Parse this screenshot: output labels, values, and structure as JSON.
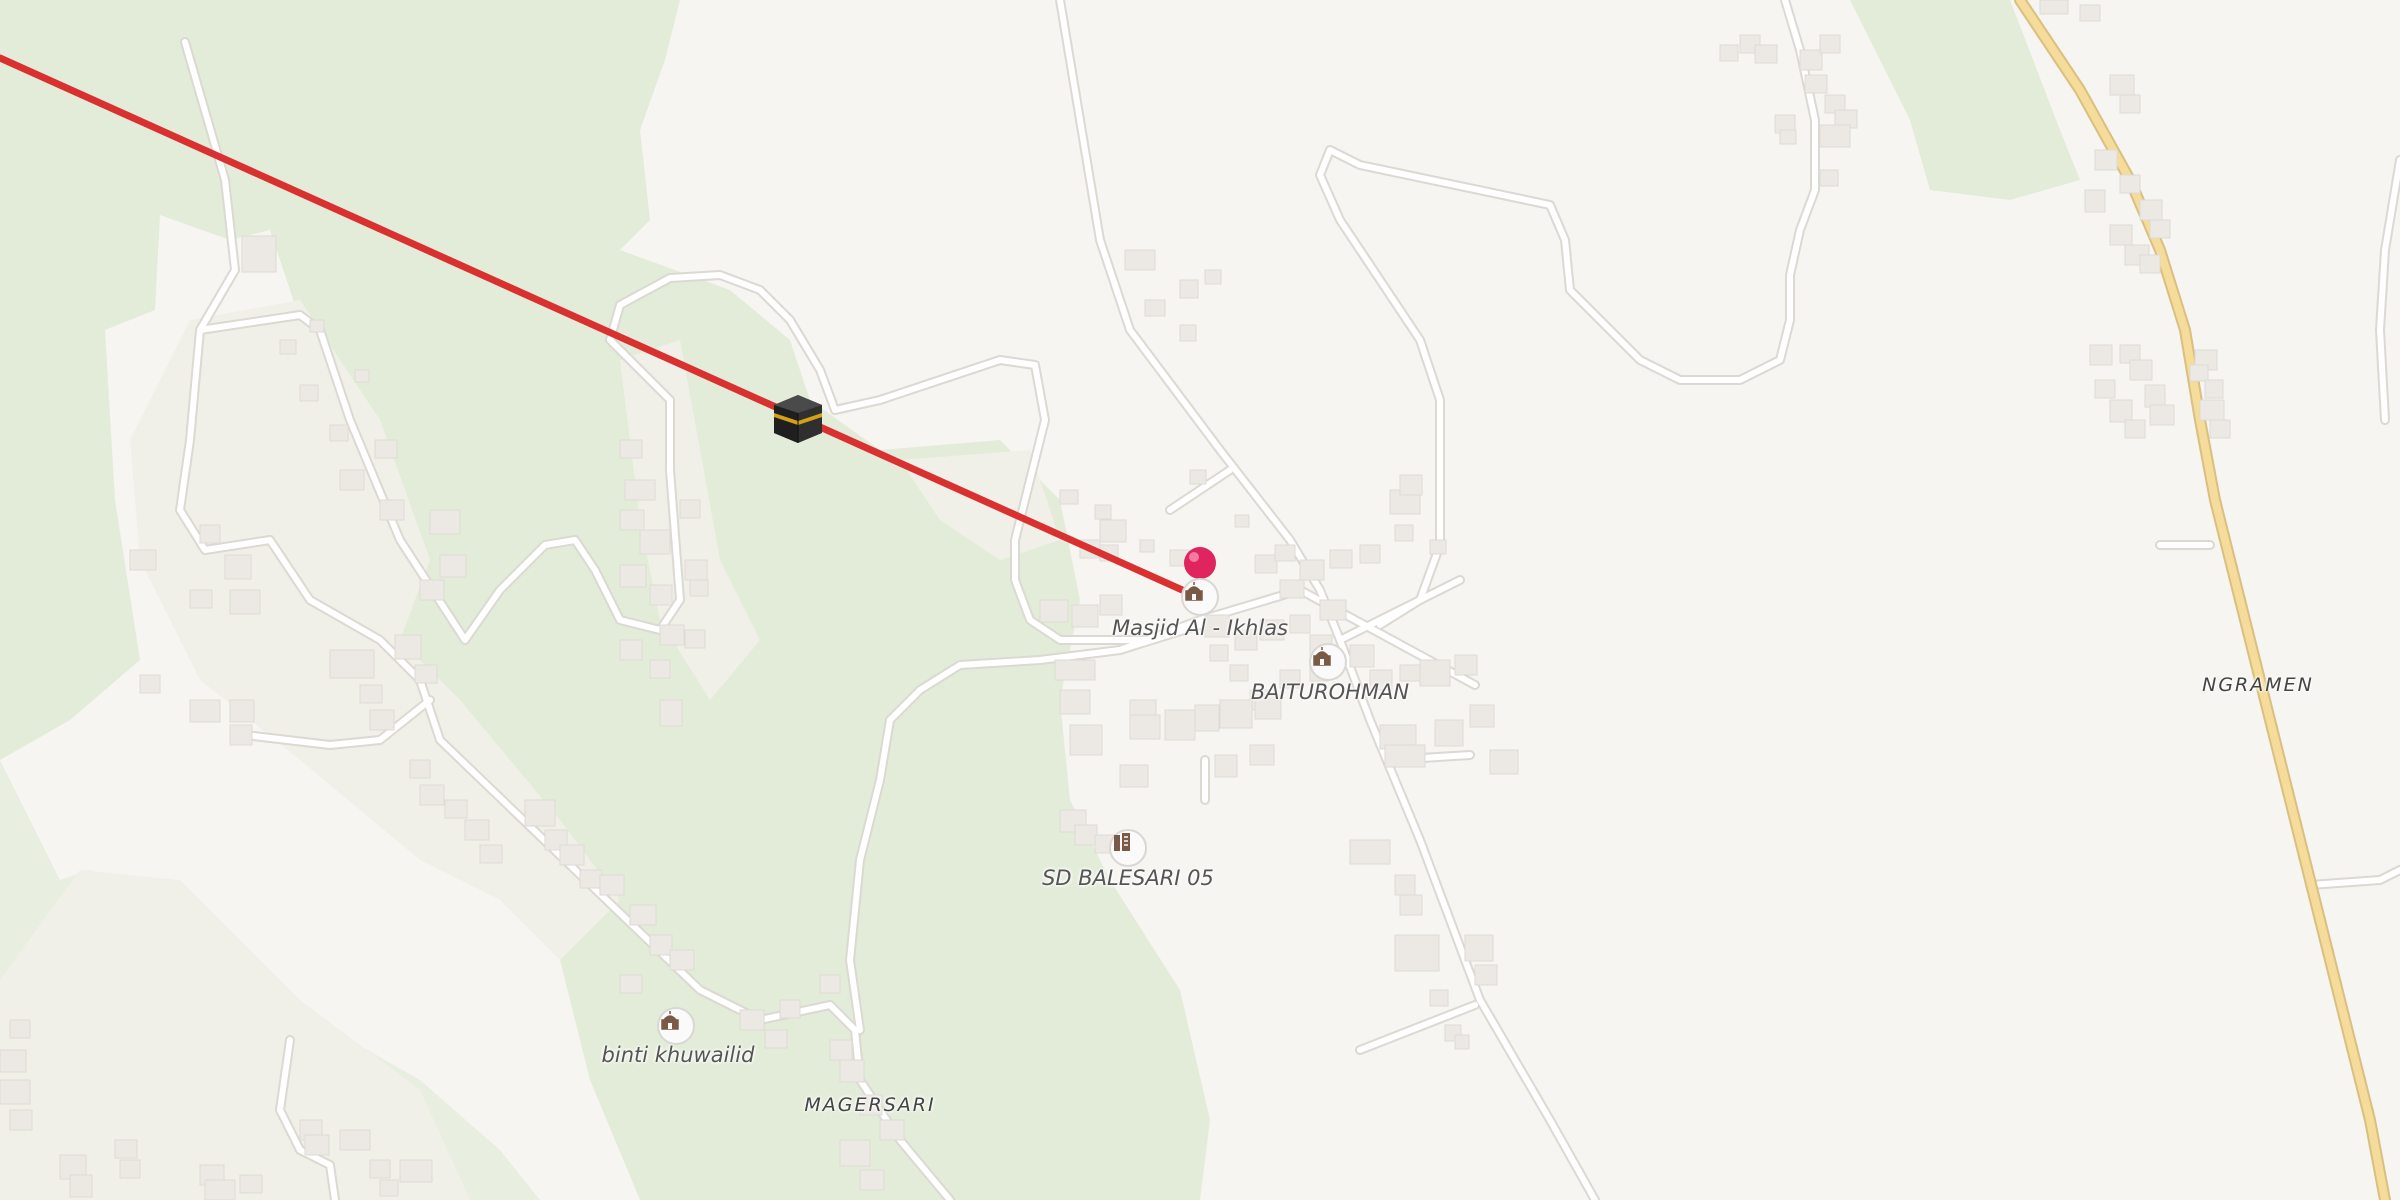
{
  "map": {
    "place_labels": [
      {
        "id": "masjid-al-ikhlas",
        "text": "Masjid Al - Ikhlas",
        "kind": "mosque"
      },
      {
        "id": "baiturohman",
        "text": "BAITUROHMAN",
        "kind": "mosque"
      },
      {
        "id": "sd-balesari-05",
        "text": "SD BALESARI 05",
        "kind": "school"
      },
      {
        "id": "binti-khuwailid",
        "text": "binti khuwailid",
        "kind": "mosque"
      }
    ],
    "area_labels": [
      {
        "id": "ngramen",
        "text": "NGRAMEN"
      },
      {
        "id": "magersari",
        "text": "MAGERSARI"
      }
    ],
    "icons": {
      "kaaba": "kaaba-icon",
      "pin": "location-pin-icon",
      "mosque": "mosque-icon",
      "school": "school-icon"
    },
    "colors": {
      "background": "#f7f5f1",
      "forest": "#e3ecd9",
      "road": "#ffffff",
      "road_casing": "#dcd8d2",
      "main_road": "#f6dc9a",
      "qibla_line": "#d93030",
      "pin": "#e0245e",
      "building": "#ece8e3"
    }
  }
}
